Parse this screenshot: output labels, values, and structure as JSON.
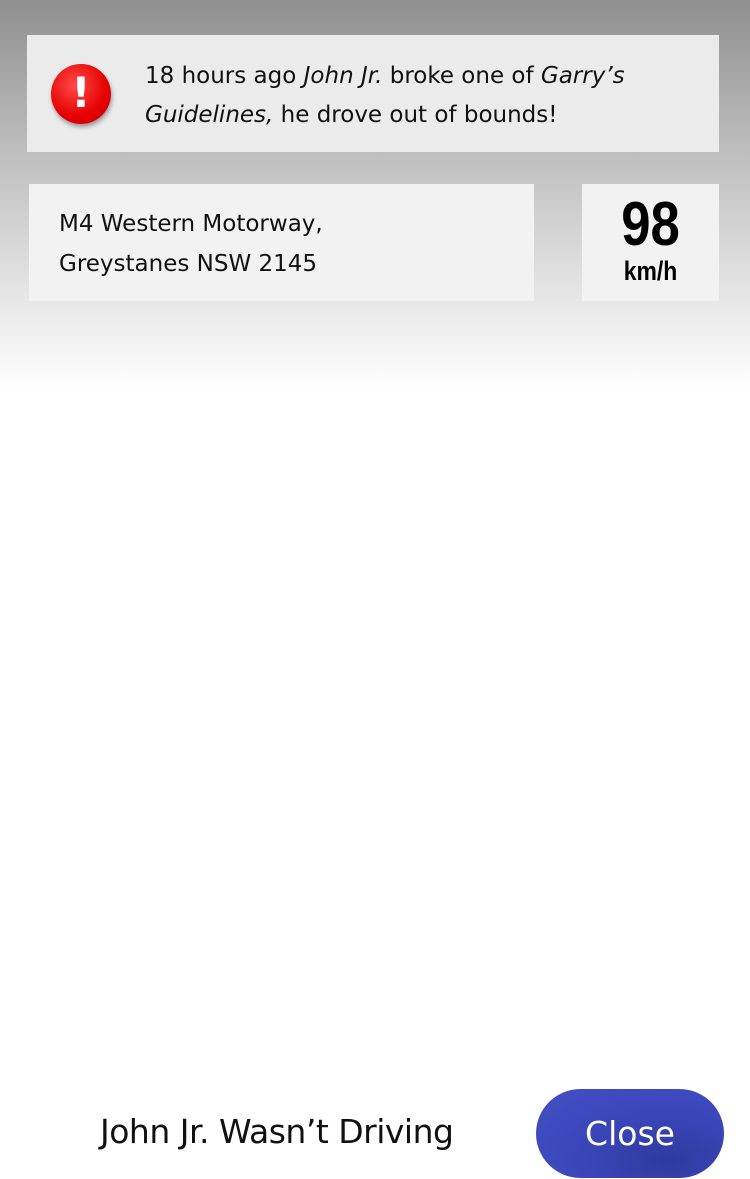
{
  "alert": {
    "icon": "exclamation-icon",
    "icon_glyph": "!",
    "icon_color": "#e60000",
    "time_ago": "18 hours ago",
    "driver_name": "John Jr.",
    "middle_text": " broke one of ",
    "guidelines_name": "Garry’s Guidelines,",
    "end_text": " he drove out of bounds!"
  },
  "location": {
    "line1": "M4 Western Motorway,",
    "line2": "Greystanes NSW 2145"
  },
  "speed": {
    "value": "98",
    "unit": "km/h"
  },
  "actions": {
    "not_driving_label": "John Jr. Wasn’t Driving",
    "close_label": "Close",
    "close_color": "#3a46b8"
  }
}
